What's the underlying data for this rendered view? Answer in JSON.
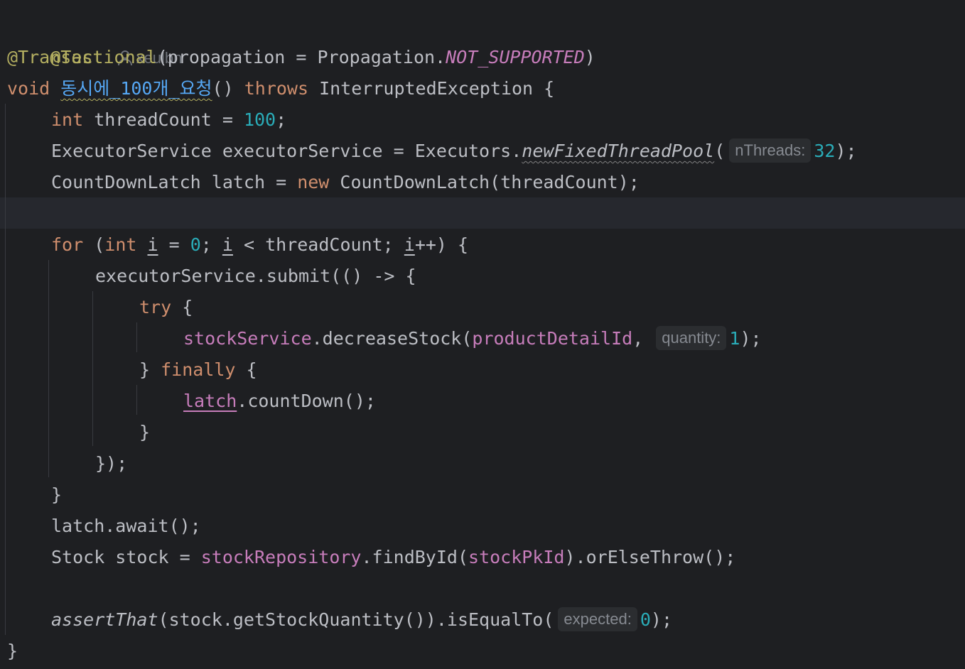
{
  "author": "xeulbn",
  "code": {
    "l1_ann": "@Test",
    "l2_ann": "@Transactional",
    "l2_open": "(propagation = Propagation.",
    "l2_const": "NOT_SUPPORTED",
    "l2_close": ")",
    "l3_void": "void",
    "l3_method": "동시에_100개_요청",
    "l3_paren": "()",
    "l3_throws": "throws",
    "l3_rest": " InterruptedException {",
    "l4_int": "int",
    "l4_mid": " threadCount = ",
    "l4_num": "100",
    "l4_end": ";",
    "l5_start": "ExecutorService executorService = Executors.",
    "l5_method": "newFixedThreadPool",
    "l5_paren": "(",
    "l5_hint": "nThreads:",
    "l5_num": "32",
    "l5_end": ");",
    "l6_start": "CountDownLatch latch = ",
    "l6_new": "new",
    "l6_rest": " CountDownLatch(threadCount);",
    "l8_for": "for",
    "l8_paren": " (",
    "l8_int": "int",
    "l8_sp": " ",
    "l8_i1": "i",
    "l8_eq": " = ",
    "l8_zero": "0",
    "l8_semi": "; ",
    "l8_i2": "i",
    "l8_lt": " < threadCount; ",
    "l8_i3": "i",
    "l8_end": "++) {",
    "l9_text": "executorService.submit(() -> {",
    "l10_try": "try",
    "l10_brace": " {",
    "l11_field": "stockService",
    "l11_mid": ".decreaseStock(",
    "l11_arg": "productDetailId",
    "l11_comma": ",",
    "l11_hint": "quantity:",
    "l11_num": "1",
    "l11_end": ");",
    "l12_close": "} ",
    "l12_finally": "finally",
    "l12_brace": " {",
    "l13_latch": "latch",
    "l13_rest": ".countDown();",
    "l14_text": "}",
    "l15_text": "});",
    "l16_text": "}",
    "l17_text": "latch.await();",
    "l18_start": "Stock stock = ",
    "l18_field": "stockRepository",
    "l18_mid": ".findById(",
    "l18_arg": "stockPkId",
    "l18_end": ").orElseThrow();",
    "l20_static": "assertThat",
    "l20_mid": "(stock.getStockQuantity()).isEqualTo(",
    "l20_hint": "expected:",
    "l20_num": "0",
    "l20_end": ");",
    "l21_text": "}"
  },
  "colors": {
    "background": "#1e1f22",
    "caret_line": "#26282e",
    "annotation": "#b3ae60",
    "keyword": "#cf8e6d",
    "number": "#2aacb8",
    "field": "#c77dbb",
    "method_decl": "#56a8f5",
    "text": "#bcbec4",
    "hint_text": "#868a91",
    "hint_bg": "#2b2d30"
  },
  "icons": {
    "author": "person-icon"
  }
}
